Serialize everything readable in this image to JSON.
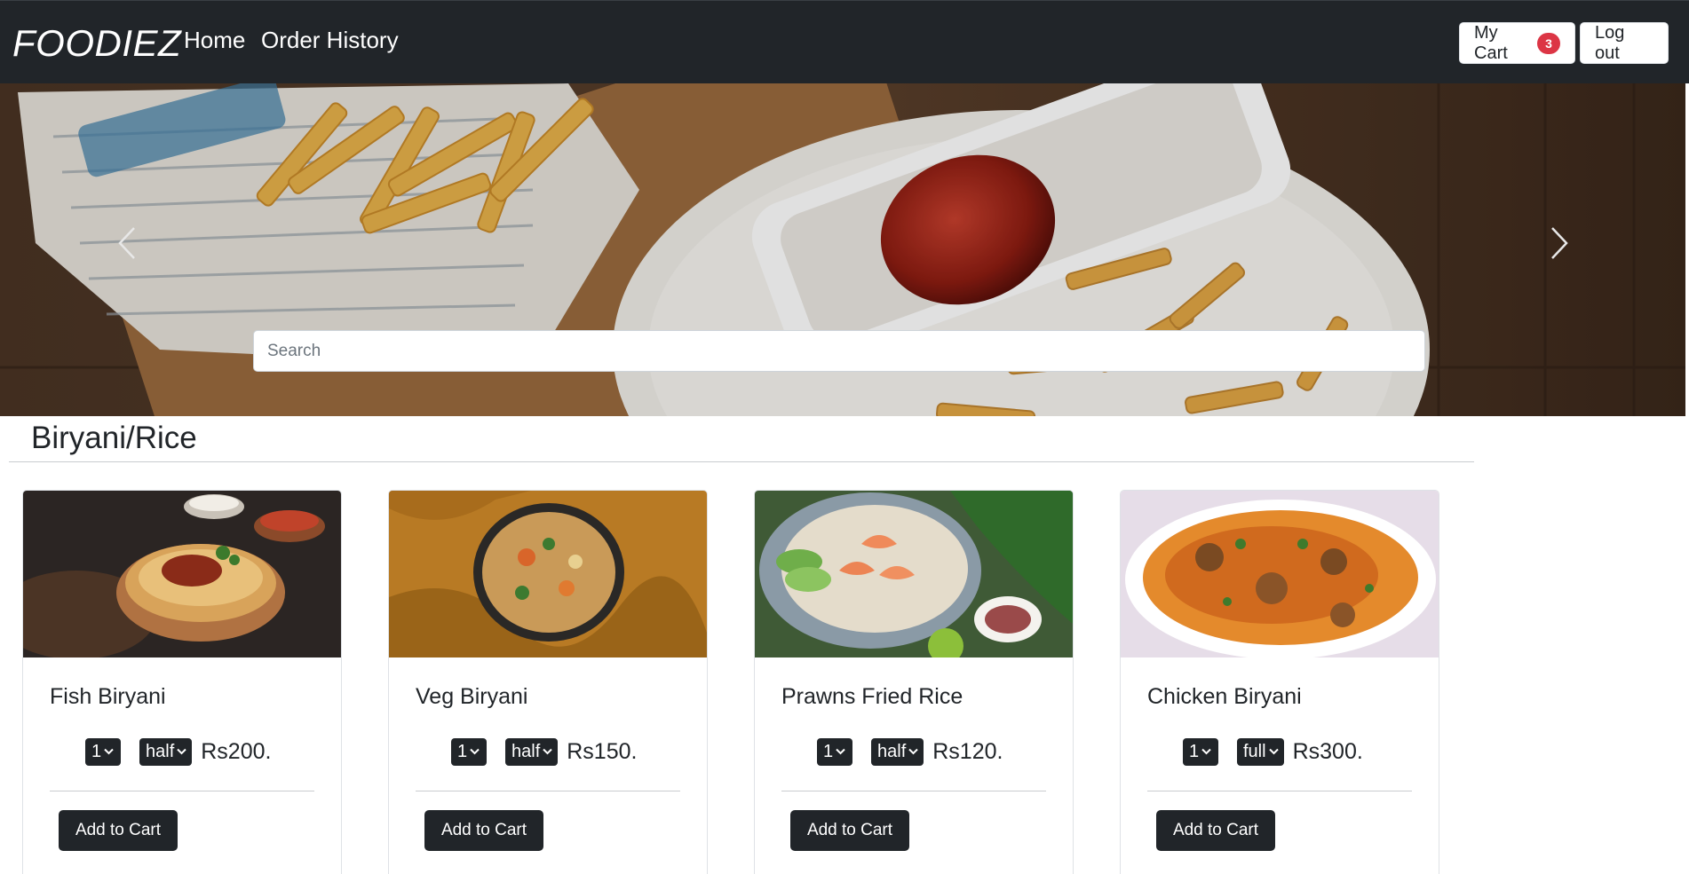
{
  "navbar": {
    "brand": "FOODIEZ",
    "links": {
      "home": "Home",
      "order_history": "Order History"
    },
    "cart_label": "My Cart",
    "cart_count": "3",
    "logout_label": "Log out"
  },
  "carousel": {
    "search_placeholder": "Search",
    "prev_icon": "chevron-left-icon",
    "next_icon": "chevron-right-icon"
  },
  "category": {
    "title": "Biryani/Rice"
  },
  "items": [
    {
      "name": "Fish Biryani",
      "quantity": "1",
      "size": "half",
      "price": "Rs200.",
      "button": "Add to Cart"
    },
    {
      "name": "Veg Biryani",
      "quantity": "1",
      "size": "half",
      "price": "Rs150.",
      "button": "Add to Cart"
    },
    {
      "name": "Prawns Fried Rice",
      "quantity": "1",
      "size": "half",
      "price": "Rs120.",
      "button": "Add to Cart"
    },
    {
      "name": "Chicken Biryani",
      "quantity": "1",
      "size": "full",
      "price": "Rs300.",
      "button": "Add to Cart"
    }
  ],
  "colors": {
    "navbar": "#212529",
    "badge": "#dc3545",
    "button_dark": "#212529"
  }
}
